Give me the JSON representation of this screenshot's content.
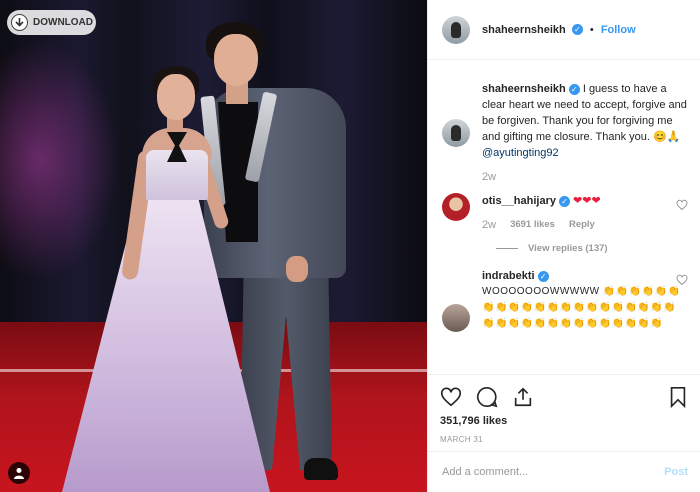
{
  "photo": {
    "download_label": "DOWNLOAD"
  },
  "header": {
    "username": "shaheernsheikh",
    "follow_label": "Follow",
    "separator": "•"
  },
  "caption": {
    "username": "shaheernsheikh",
    "text": "I guess to have a clear heart we need to accept, forgive and be forgiven. Thank you for forgiving me and gifting me closure. Thank you. 😊🙏",
    "mention": "@ayutingting92",
    "time": "2w"
  },
  "comments": [
    {
      "username": "otis__hahijary",
      "text": "❤❤❤",
      "time": "2w",
      "likes": "3691 likes",
      "reply_label": "Reply",
      "view_replies": "View replies (137)"
    },
    {
      "username": "indrabekti",
      "text": "WOOOOOOOWWWWW 👏👏👏👏👏👏👏👏👏👏👏👏👏👏👏👏👏👏👏👏👏👏👏👏👏👏👏👏👏👏👏👏👏👏👏"
    }
  ],
  "actions": {
    "likes": "351,796 likes",
    "date": "MARCH 31"
  },
  "add_comment": {
    "placeholder": "Add a comment...",
    "post_label": "Post"
  }
}
